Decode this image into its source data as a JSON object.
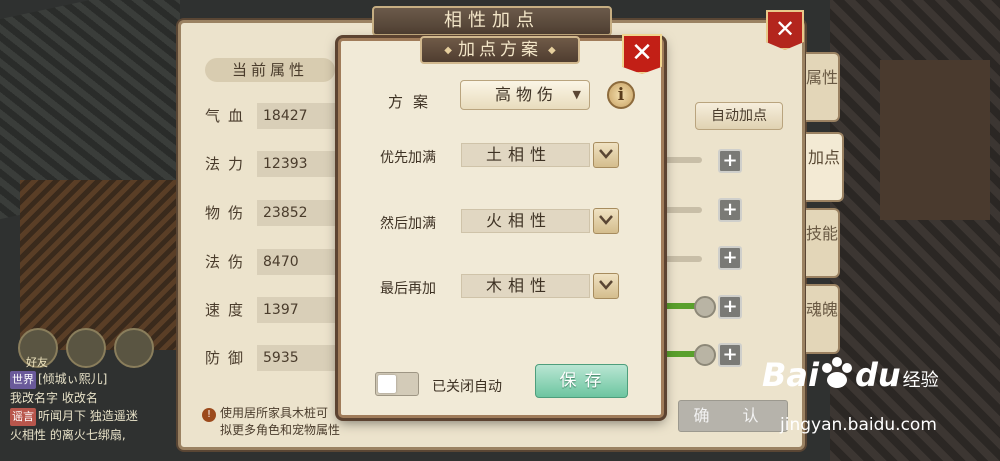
{
  "background": {
    "chat_lines": [
      {
        "tag": "世界",
        "text": "[倾城ぃ熙儿]"
      },
      {
        "tag": "",
        "text": "我改名字 收改名"
      },
      {
        "tag": "谣言",
        "text": "听闻月下 独造遥迷"
      },
      {
        "tag": "",
        "text": "火相性 的离火七绑扇,"
      }
    ],
    "friend_label": "好友"
  },
  "back_panel": {
    "title": "相性加点",
    "close_label": "✕",
    "side_tabs": [
      "属性",
      "加点",
      "技能",
      "魂魄"
    ],
    "current_attrs_header": "当前属性",
    "attributes": [
      {
        "label": "气血",
        "value": "18427"
      },
      {
        "label": "法力",
        "value": "12393"
      },
      {
        "label": "物伤",
        "value": "23852"
      },
      {
        "label": "法伤",
        "value": "8470"
      },
      {
        "label": "速度",
        "value": "1397"
      },
      {
        "label": "防御",
        "value": "5935"
      }
    ],
    "auto_button": "自动加点",
    "plus_label": "+",
    "confirm_button": "确 认",
    "hint_icon": "!",
    "hint_line1": "使用居所家具木桩可",
    "hint_line2": "拟更多角色和宠物属性"
  },
  "modal": {
    "title": "加点方案",
    "title_ornament": "◆",
    "close_label": "✕",
    "plan_label": "方案",
    "plan_value": "高物伤",
    "plan_caret": "▼",
    "info_label": "i",
    "priority": [
      {
        "label": "优先加满",
        "value": "土相性"
      },
      {
        "label": "然后加满",
        "value": "火相性"
      },
      {
        "label": "最后再加",
        "value": "木相性"
      }
    ],
    "toggle_label": "已关闭自动",
    "save_button": "保存"
  },
  "watermark": {
    "brand": "Bai",
    "brand_tail": "du",
    "sub": "经验",
    "url": "jingyan.baidu.com"
  },
  "colors": {
    "panel_bg": "#ece3cc",
    "modal_bg": "#f1ead7",
    "close_red": "#c21f16",
    "save_green": "#6dc5a0"
  }
}
